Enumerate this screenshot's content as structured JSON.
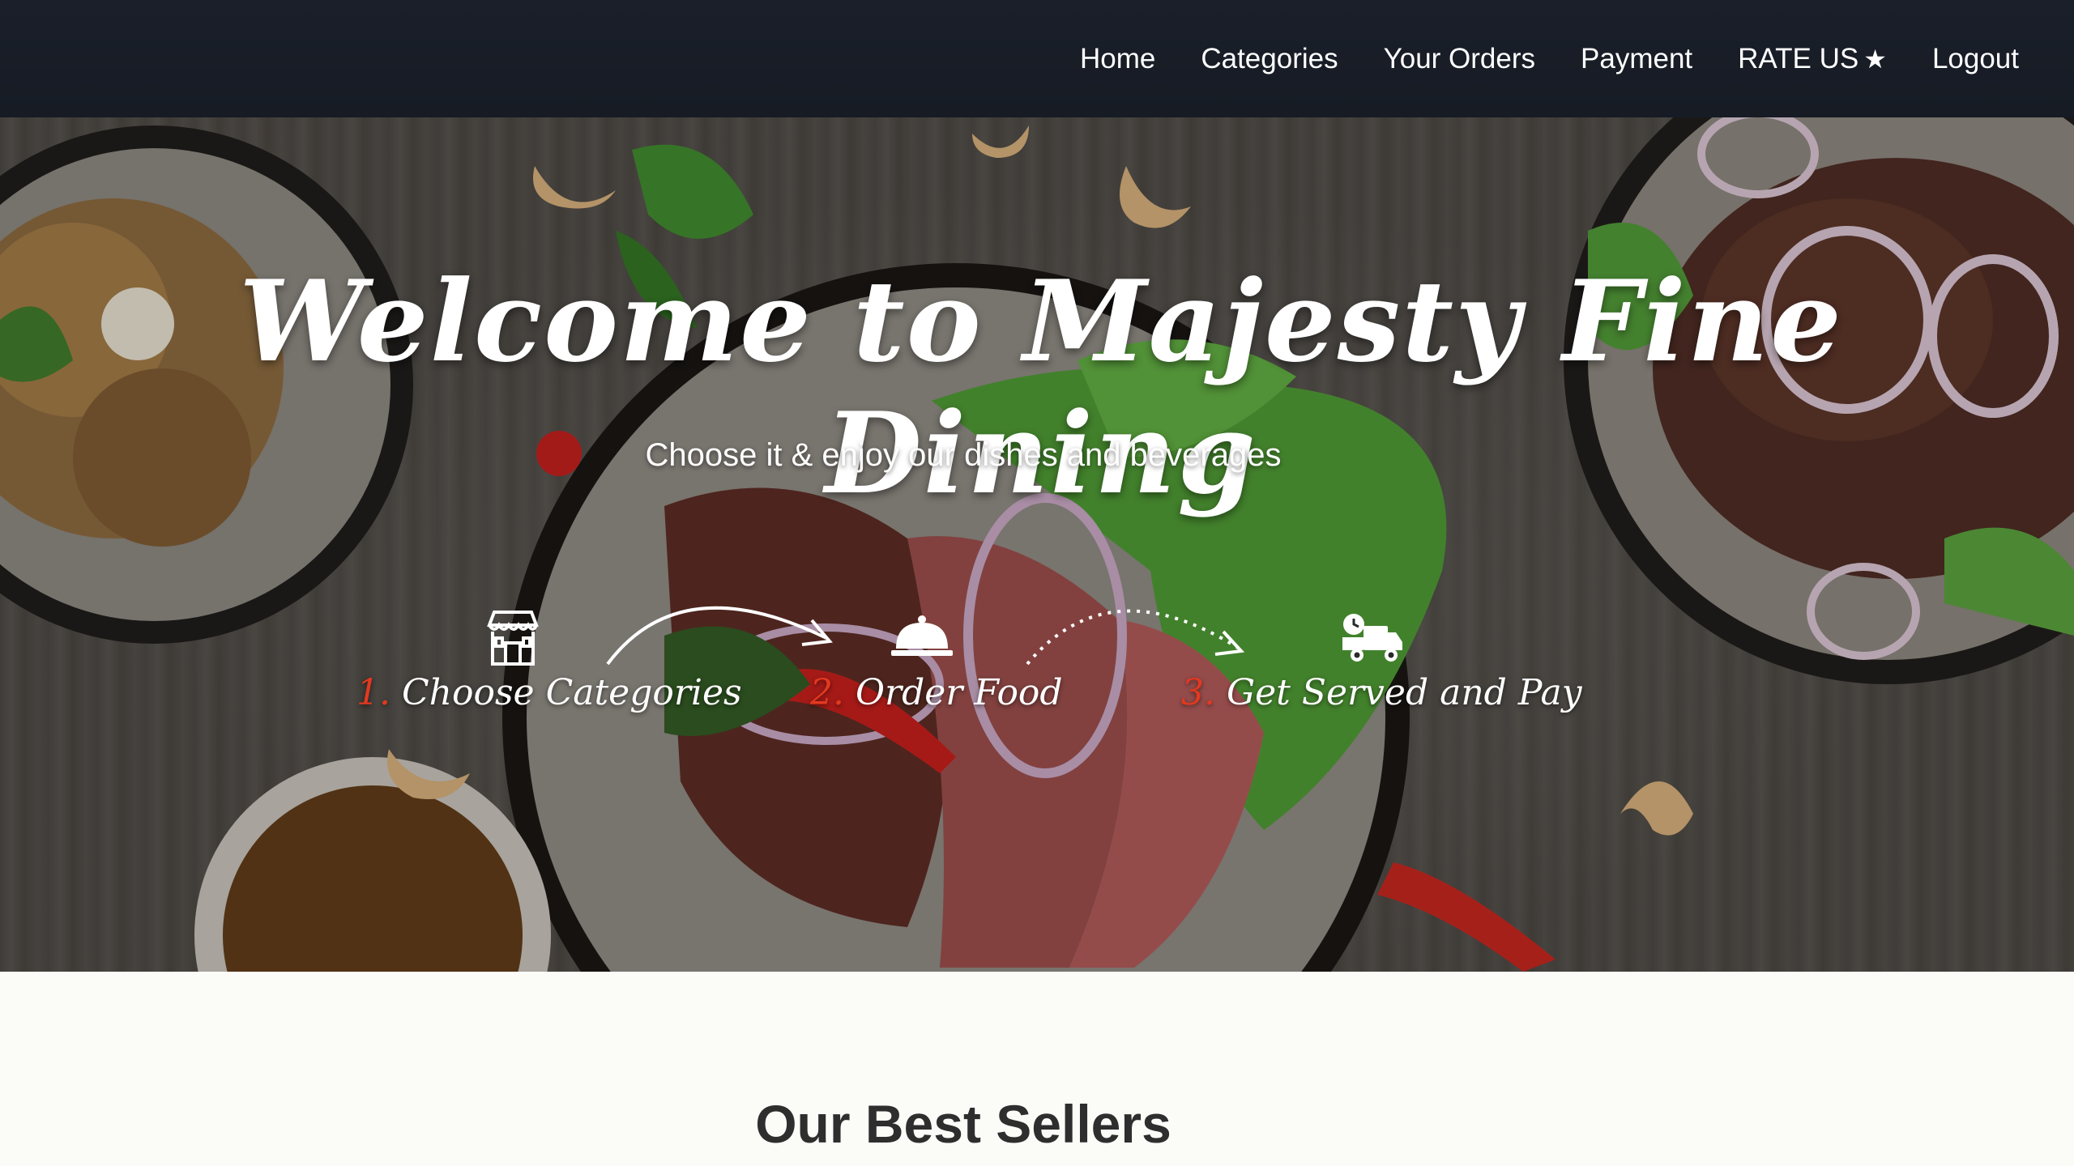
{
  "nav": {
    "home": "Home",
    "categories": "Categories",
    "your_orders": "Your Orders",
    "payment": "Payment",
    "rate_us": "RATE US",
    "rate_star": "★",
    "logout": "Logout"
  },
  "hero": {
    "title": "Welcome to Majesty Fine Dining",
    "subtitle": "Choose it & enjoy our dishes and beverages",
    "steps": [
      {
        "number": "1.",
        "label": "Choose Categories",
        "icon": "store-icon"
      },
      {
        "number": "2.",
        "label": "Order Food",
        "icon": "food-cloche-icon"
      },
      {
        "number": "3.",
        "label": "Get Served and Pay",
        "icon": "delivery-truck-icon"
      }
    ]
  },
  "bestsellers": {
    "title": "Our Best Sellers"
  },
  "colors": {
    "navbar_bg": "#161b24",
    "step_number": "#e2391f",
    "page_bg": "#fbfbf8"
  }
}
